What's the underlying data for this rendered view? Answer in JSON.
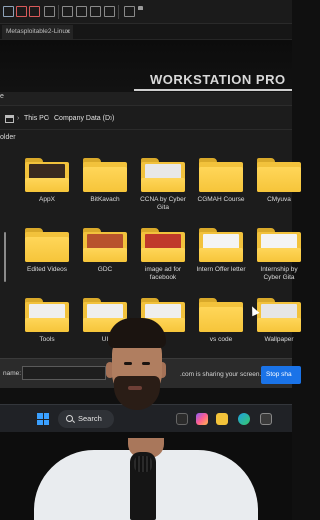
{
  "vm_tab": {
    "title": "Metasploitable2-Linux",
    "close": "×"
  },
  "desktop": {
    "title": "WORKSTATION PRO"
  },
  "explorer": {
    "header_partial": "e",
    "breadcrumb": [
      "This PC",
      "Company Data (D:)"
    ],
    "separator": "›",
    "sub_label": "older",
    "folders": [
      {
        "name": "AppX"
      },
      {
        "name": "BitKavach"
      },
      {
        "name": "CCNA by Cyber Gita"
      },
      {
        "name": "CGMAH Course"
      },
      {
        "name": "CMyuva"
      },
      {
        "name": "Edited Videos"
      },
      {
        "name": "GDC"
      },
      {
        "name": "image ad for facebook"
      },
      {
        "name": "Intern Offer letter"
      },
      {
        "name": "Internship by Cyber Gita"
      },
      {
        "name": "Tools"
      },
      {
        "name": "UI"
      },
      {
        "name": ""
      },
      {
        "name": "vs code"
      },
      {
        "name": "Wallpaper"
      }
    ]
  },
  "save_bar": {
    "name_label": "name:",
    "share_text": ".com is sharing your screen.",
    "stop_label": "Stop sha"
  },
  "taskbar": {
    "search_label": "Search"
  },
  "colors": {
    "folder": "#f6c53a",
    "accent": "#1a73e8",
    "stop_button": "#1a73e8"
  },
  "icons": [
    "windows-start-icon",
    "search-icon",
    "edge-icon",
    "copilot-icon",
    "file-explorer-icon",
    "store-icon"
  ]
}
